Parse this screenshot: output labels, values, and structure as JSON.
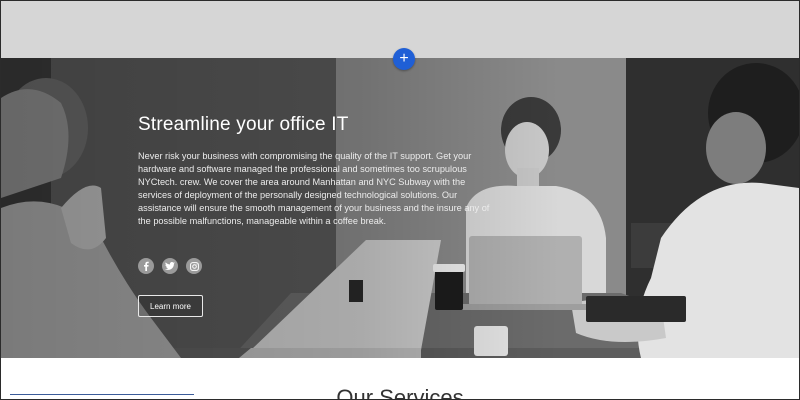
{
  "hero": {
    "title": "Streamline your office IT",
    "description": "Never risk your business with compromising the quality of the IT support. Get your hardware and software managed the professional and sometimes too scrupulous NYCtech. crew. We cover the area around Manhattan and NYC Subway with the services of deployment of the personally designed technological solutions. Our assistance will ensure the smooth management of your business and the insure any of the possible malfunctions, manageable within a coffee break.",
    "button_label": "Learn more",
    "social_icons": [
      "facebook-icon",
      "twitter-icon",
      "instagram-icon"
    ]
  },
  "editor": {
    "add_button_symbol": "+"
  },
  "services": {
    "title": "Our Services"
  },
  "colors": {
    "top_band": "#d6d6d6",
    "add_button": "#1f5fd6",
    "hero_text": "#ffffff",
    "services_underline": "#3b5b99"
  }
}
